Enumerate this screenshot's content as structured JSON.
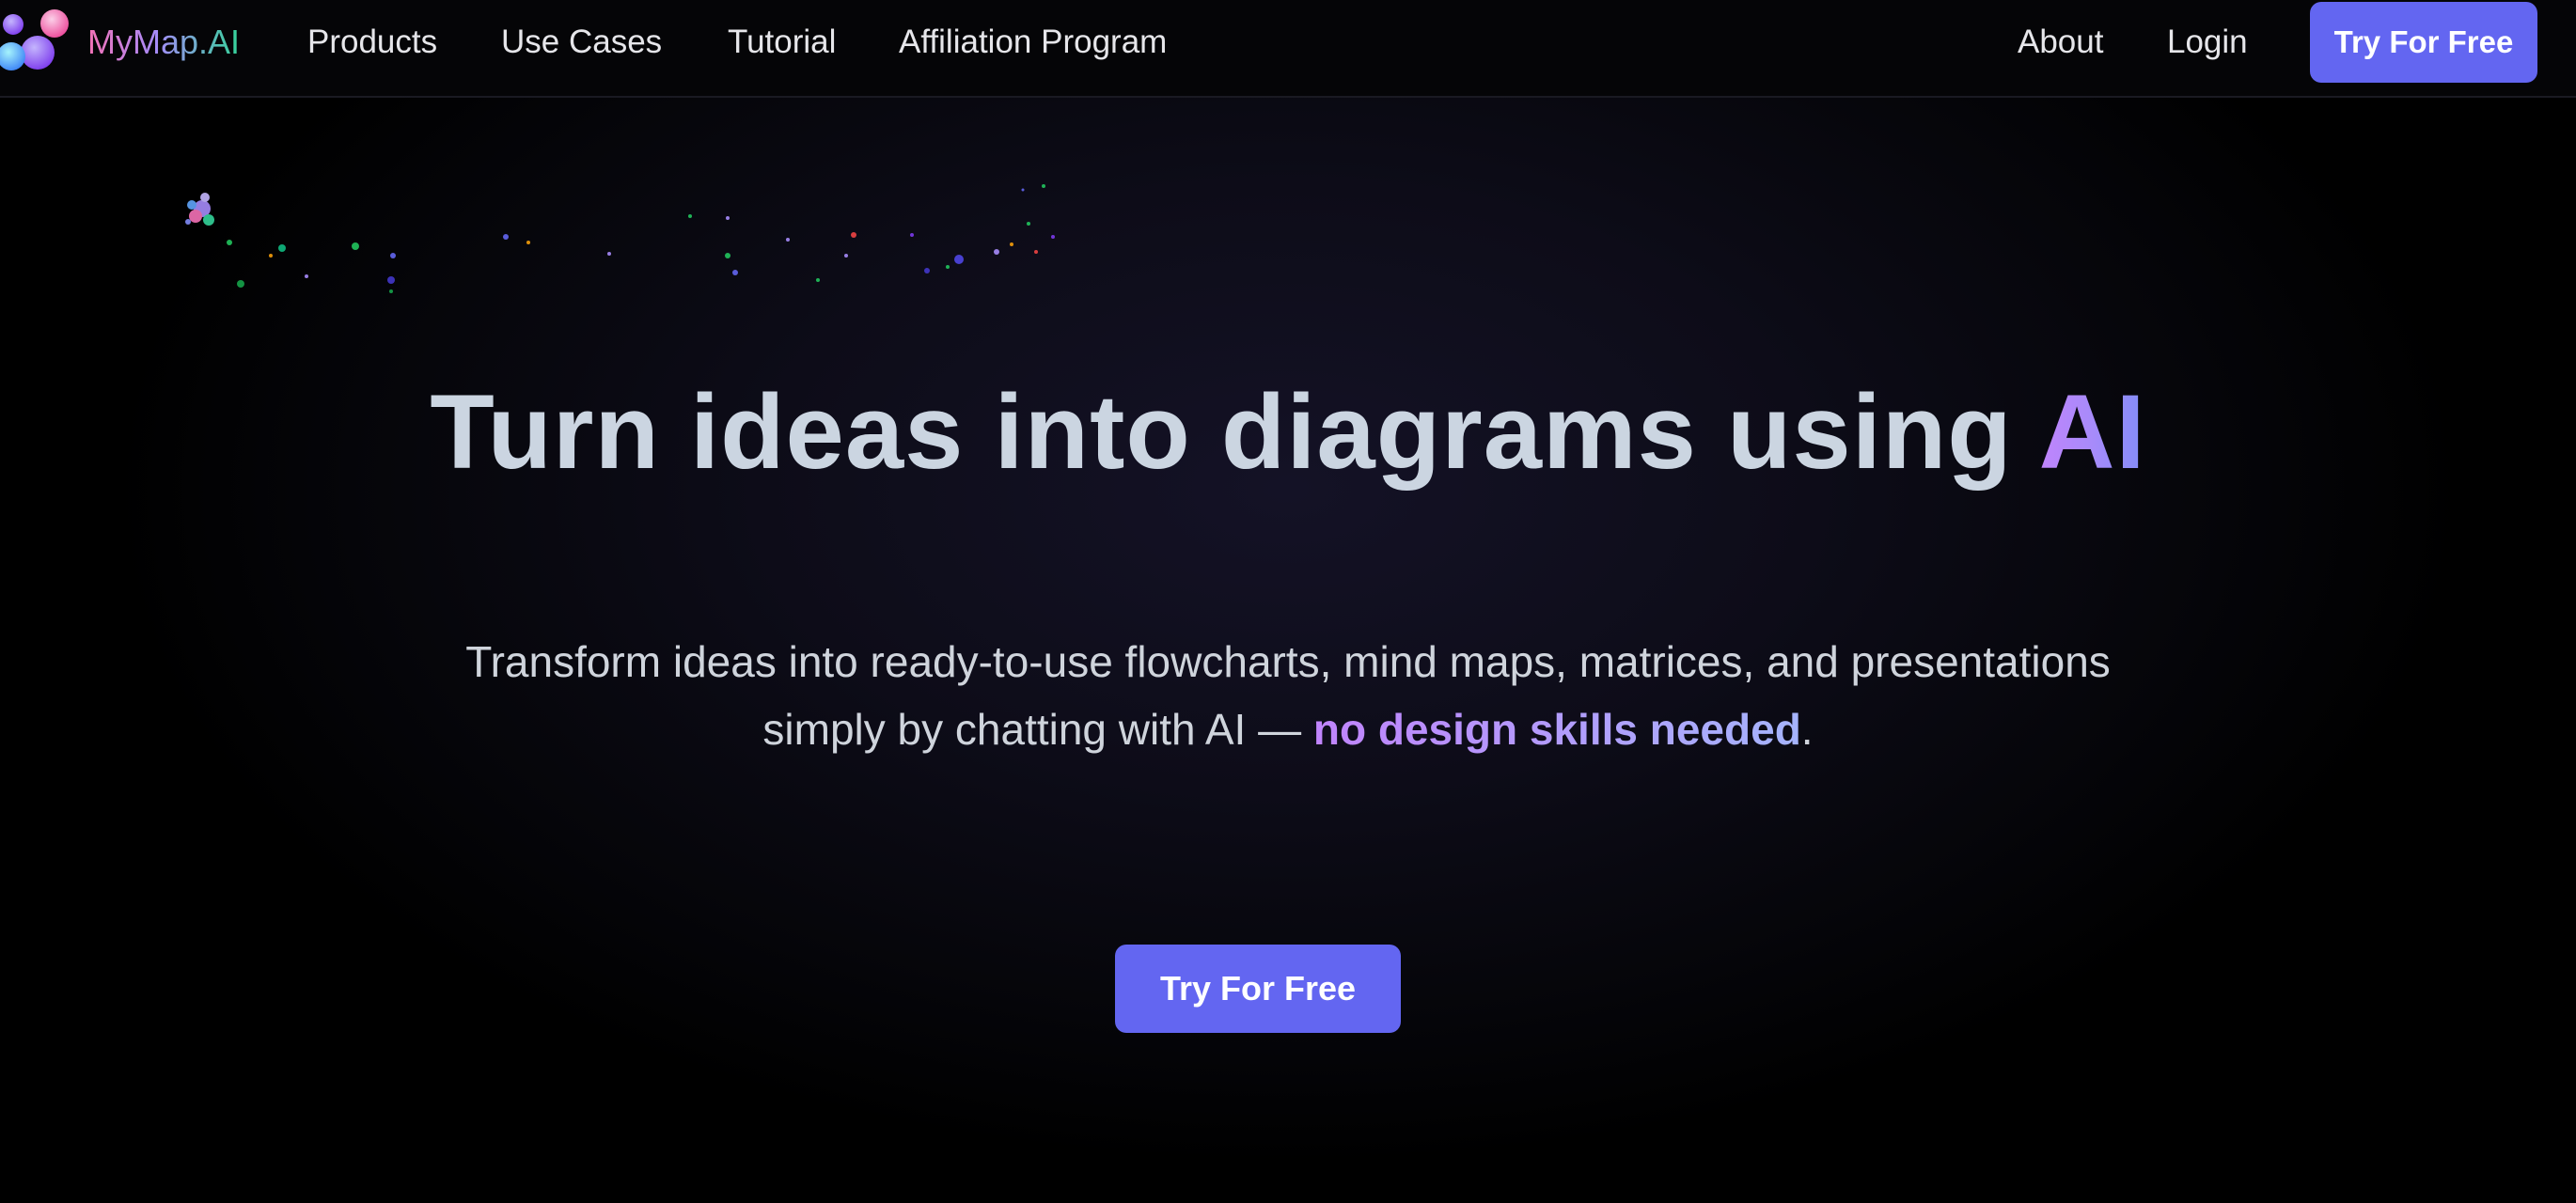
{
  "nav": {
    "brand": "MyMap.AI",
    "links": [
      "Products",
      "Use Cases",
      "Tutorial",
      "Affiliation Program"
    ],
    "about": "About",
    "login": "Login",
    "cta": "Try For Free"
  },
  "hero": {
    "title_main": "Turn ideas into diagrams using ",
    "title_accent": "AI",
    "subtitle_line1": "Transform ideas into ready-to-use flowcharts, mind maps, matrices, and presentations",
    "subtitle_line2_start": "simply by chatting with AI — ",
    "subtitle_highlight": "no design skills needed",
    "subtitle_end": ".",
    "cta": "Try For Free"
  },
  "colors": {
    "accent": "#6366f1",
    "background": "#000000",
    "title_text": "#cbd5e1",
    "gradient_start": "#c084fc",
    "gradient_end": "#818cf8"
  },
  "icons": {
    "logo": "mymap-logo-icon"
  }
}
